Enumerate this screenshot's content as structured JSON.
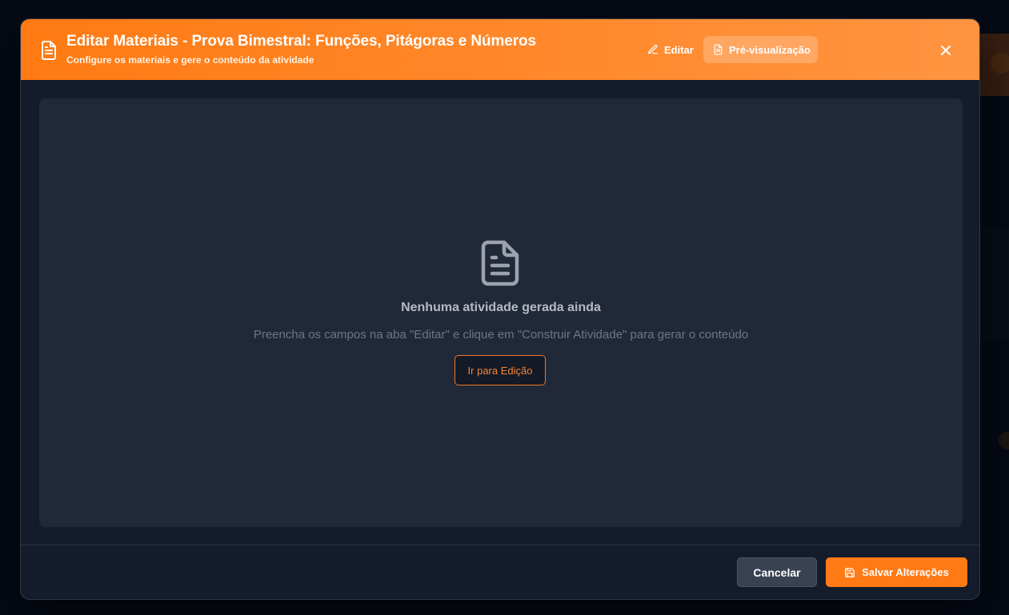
{
  "header": {
    "title": "Editar Materiais - Prova Bimestral: Funções, Pitágoras e Números",
    "subtitle": "Configure os materiais e gere o conteúdo da atividade",
    "icon": "file-text-icon"
  },
  "tabs": [
    {
      "label": "Editar",
      "icon": "pencil-icon",
      "active": false
    },
    {
      "label": "Pré-visualização",
      "icon": "file-text-icon",
      "active": true
    }
  ],
  "empty_state": {
    "icon": "file-text-icon",
    "title": "Nenhuma atividade gerada ainda",
    "description": "Preencha os campos na aba \"Editar\" e clique em \"Construir Atividade\" para gerar o conteúdo",
    "button_label": "Ir para Edição"
  },
  "footer": {
    "cancel_label": "Cancelar",
    "save_label": "Salvar Alterações",
    "save_icon": "save-icon"
  },
  "colors": {
    "accent": "#ff7a15",
    "modal_bg": "#141b2a",
    "panel_bg": "#212938"
  }
}
